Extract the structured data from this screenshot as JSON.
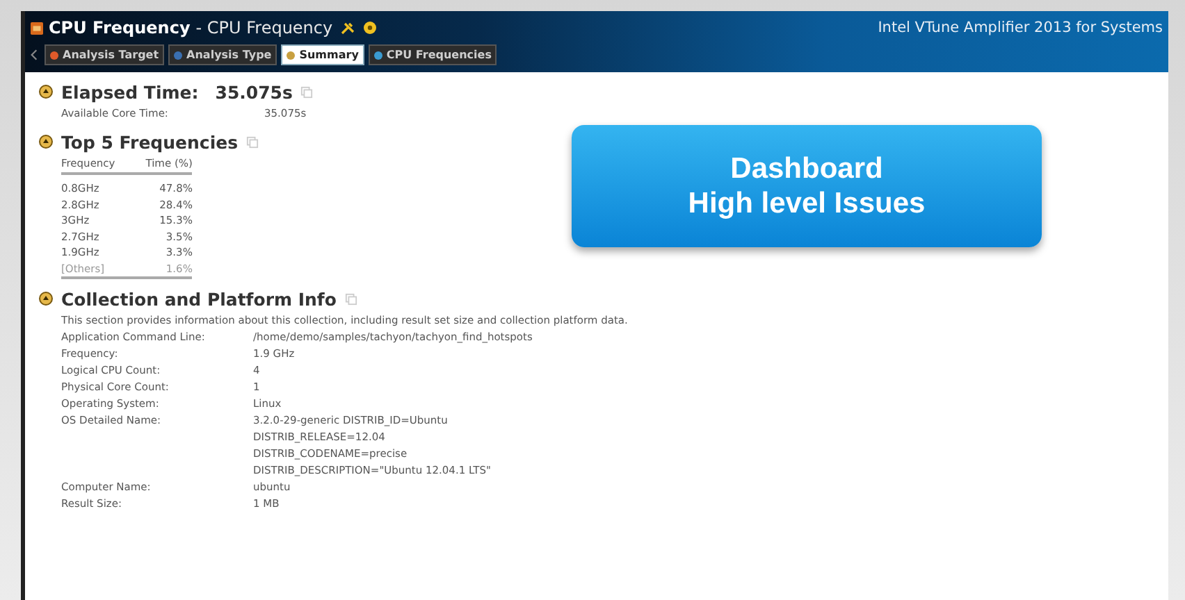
{
  "window": {
    "title": "CPU Frequency",
    "subtitle": "- CPU Frequency",
    "product": "Intel VTune Amplifier 2013 for Systems"
  },
  "tabs": [
    {
      "label": "Analysis Target",
      "kind": "target",
      "selected": false
    },
    {
      "label": "Analysis Type",
      "kind": "type",
      "selected": false
    },
    {
      "label": "Summary",
      "kind": "summary",
      "selected": true
    },
    {
      "label": "CPU Frequencies",
      "kind": "frequencies",
      "selected": false
    }
  ],
  "elapsed": {
    "title": "Elapsed Time:",
    "value": "35.075s",
    "expanded": true,
    "rows": [
      {
        "label": "Available Core Time:",
        "value": "35.075s"
      }
    ]
  },
  "frequencies": {
    "title": "Top 5 Frequencies",
    "expanded": true,
    "columns": [
      "Frequency",
      "Time (%)"
    ],
    "rows": [
      {
        "frequency": "0.8GHz",
        "time": "47.8%",
        "muted": false
      },
      {
        "frequency": "2.8GHz",
        "time": "28.4%",
        "muted": false
      },
      {
        "frequency": "3GHz",
        "time": "15.3%",
        "muted": false
      },
      {
        "frequency": "2.7GHz",
        "time": "3.5%",
        "muted": false
      },
      {
        "frequency": "1.9GHz",
        "time": "3.3%",
        "muted": false
      },
      {
        "frequency": "[Others]",
        "time": "1.6%",
        "muted": true
      }
    ]
  },
  "platform": {
    "title": "Collection and Platform Info",
    "expanded": true,
    "description": "This section provides information about this collection, including result set size and collection platform data.",
    "rows": [
      {
        "label": "Application Command Line:",
        "lines": [
          "/home/demo/samples/tachyon/tachyon_find_hotspots"
        ]
      },
      {
        "label": "Frequency:",
        "lines": [
          "1.9 GHz"
        ]
      },
      {
        "label": "Logical CPU Count:",
        "lines": [
          "4"
        ]
      },
      {
        "label": "Physical Core Count:",
        "lines": [
          "1"
        ]
      },
      {
        "label": "Operating System:",
        "lines": [
          "Linux"
        ]
      },
      {
        "label": "OS Detailed Name:",
        "lines": [
          "3.2.0-29-generic DISTRIB_ID=Ubuntu",
          "DISTRIB_RELEASE=12.04",
          "DISTRIB_CODENAME=precise",
          "DISTRIB_DESCRIPTION=\"Ubuntu 12.04.1 LTS\""
        ]
      },
      {
        "label": "Computer Name:",
        "lines": [
          "ubuntu"
        ]
      },
      {
        "label": "Result Size:",
        "lines": [
          "1 MB"
        ]
      }
    ]
  },
  "callout": {
    "lines": [
      "Dashboard",
      "High level Issues"
    ]
  }
}
